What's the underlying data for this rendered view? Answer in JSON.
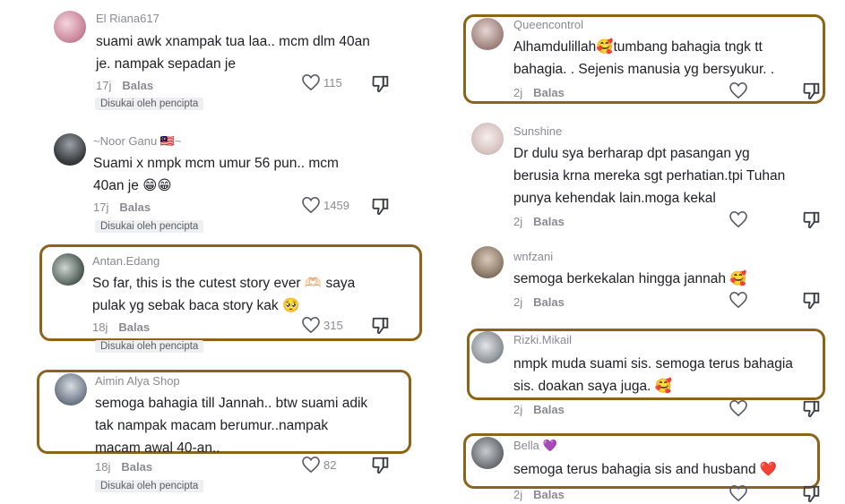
{
  "left": {
    "comments": [
      {
        "username": "El Riana617",
        "lines": [
          "suami awk xnampak tua laa.. mcm dlm 40an",
          "je. nampak sepadan je"
        ],
        "time": "17j",
        "reply": "Balas",
        "likes": "115",
        "liked_by": "Disukai oleh pencipta"
      },
      {
        "username": "~Noor Ganu 🇲🇾~",
        "lines": [
          "Suami x nmpk mcm umur 56 pun.. mcm",
          "40an je 😁😁"
        ],
        "time": "17j",
        "reply": "Balas",
        "likes": "1459",
        "liked_by": "Disukai oleh pencipta"
      },
      {
        "username": "Antan.Edang",
        "lines": [
          "So far, this is the cutest story ever 🫶🏻 saya",
          "pulak yg sebak baca story kak 🥺"
        ],
        "time": "18j",
        "reply": "Balas",
        "likes": "315",
        "liked_by": "Disukai oleh pencipta"
      },
      {
        "username": "Aimin Alya Shop",
        "lines": [
          "semoga bahagia till Jannah.. btw suami adik",
          "tak nampak macam berumur..nampak",
          "macam awal 40-an.."
        ],
        "time": "18j",
        "reply": "Balas",
        "likes": "82",
        "liked_by": "Disukai oleh pencipta"
      }
    ]
  },
  "right": {
    "comments": [
      {
        "username": "Queencontrol",
        "lines": [
          "Alhamdulillah🥰tumbang bahagia tngk tt",
          "bahagia. . Sejenis manusia yg bersyukur. ."
        ],
        "time": "2j",
        "reply": "Balas"
      },
      {
        "username": "Sunshine",
        "lines": [
          "Dr dulu sya berharap dpt pasangan yg",
          "berusia krna mereka sgt perhatian.tpi Tuhan",
          "punya kehendak lain.moga kekal"
        ],
        "time": "2j",
        "reply": "Balas"
      },
      {
        "username": "wnfzani",
        "lines": [
          "semoga berkekalan hingga jannah 🥰"
        ],
        "time": "2j",
        "reply": "Balas"
      },
      {
        "username": "Rizki.Mikail",
        "lines": [
          "nmpk muda suami sis. semoga terus bahagia",
          "sis. doakan saya juga. 🥰"
        ],
        "time": "2j",
        "reply": "Balas"
      },
      {
        "username": "Bella 💜",
        "lines": [
          "semoga terus bahagia sis and husband ❤️"
        ],
        "time": "2j",
        "reply": "Balas"
      }
    ]
  },
  "colors": {
    "highlight": "#8b6419",
    "muted": "#8a8b91",
    "text": "#202124"
  },
  "icons": {
    "like": "heart-outline-icon",
    "dislike": "thumbs-down-icon"
  }
}
